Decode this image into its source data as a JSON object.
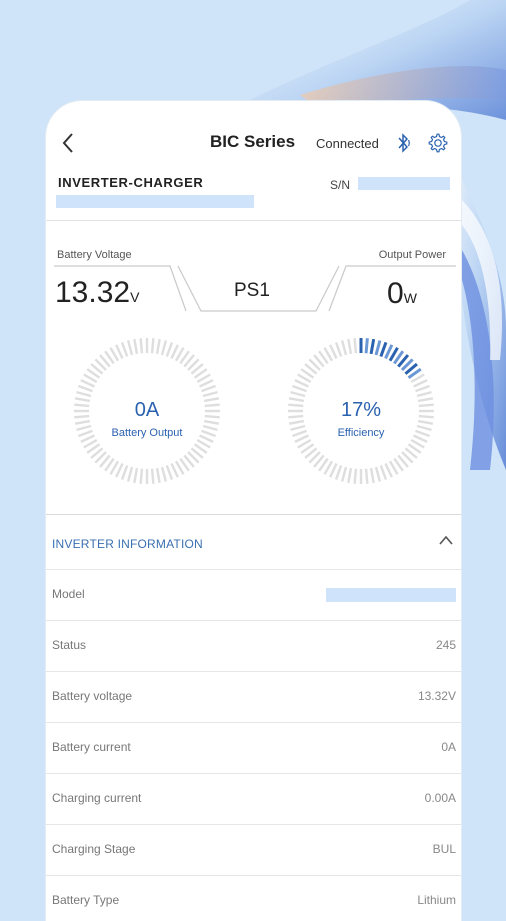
{
  "header": {
    "title": "BIC Series",
    "status": "Connected"
  },
  "device": {
    "name": "INVERTER-CHARGER",
    "sn_label": "S/N"
  },
  "readings": {
    "battery_voltage_label": "Battery Voltage",
    "battery_voltage_value": "13.32",
    "battery_voltage_unit": "V",
    "output_power_label": "Output Power",
    "output_power_value": "0",
    "output_power_unit": "W",
    "mode": "PS1"
  },
  "gauges": {
    "battery_output": {
      "value": "0A",
      "label": "Battery Output",
      "level": 0
    },
    "efficiency": {
      "value": "17%",
      "label": "Efficiency",
      "level": 0.17
    }
  },
  "section": {
    "title": "INVERTER INFORMATION",
    "rows": [
      {
        "key": "Model",
        "value": ""
      },
      {
        "key": "Status",
        "value": "245"
      },
      {
        "key": "Battery voltage",
        "value": "13.32V"
      },
      {
        "key": "Battery current",
        "value": "0A"
      },
      {
        "key": "Charging current",
        "value": "0.00A"
      },
      {
        "key": "Charging Stage",
        "value": "BUL"
      },
      {
        "key": "Battery Type",
        "value": "Lithium"
      }
    ]
  },
  "colors": {
    "accent": "#2b62b0",
    "background": "#cfe4f8",
    "placeholder_bar": "#cfe4fb"
  },
  "icons": {
    "back": "back-arrow-icon",
    "bluetooth": "bluetooth-icon",
    "settings": "gear-icon",
    "collapse": "chevron-up-icon"
  }
}
